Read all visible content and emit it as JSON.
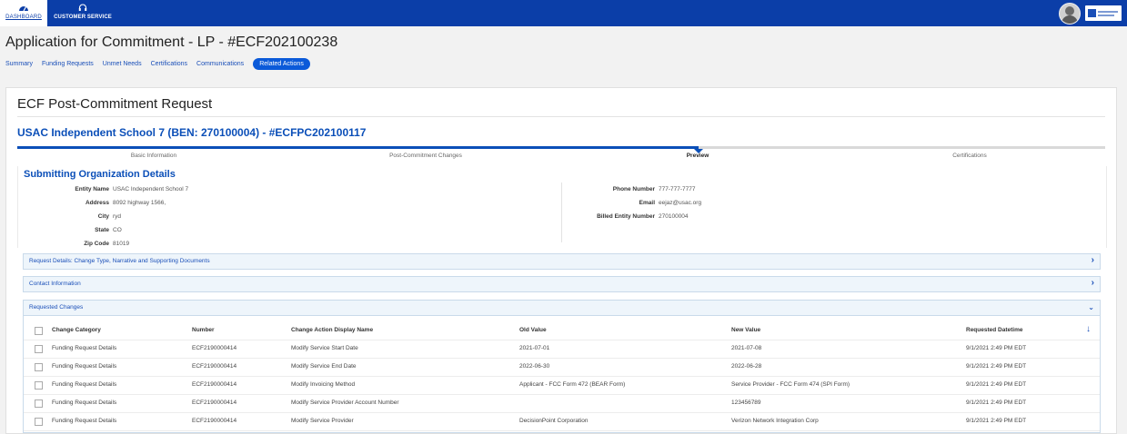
{
  "nav": {
    "dashboard": "DASHBOARD",
    "customer_service": "CUSTOMER SERVICE"
  },
  "page": {
    "title": "Application for Commitment - LP - #ECF202100238",
    "tabs": [
      {
        "label": "Summary"
      },
      {
        "label": "Funding Requests"
      },
      {
        "label": "Unmet Needs"
      },
      {
        "label": "Certifications"
      },
      {
        "label": "Communications"
      },
      {
        "label": "Related Actions",
        "active": true
      }
    ]
  },
  "card": {
    "title": "ECF Post-Commitment Request",
    "entity_header": "USAC Independent School 7 (BEN: 270100004) - #ECFPC202100117",
    "steps": [
      "Basic Information",
      "Post-Commitment Changes",
      "Preview",
      "Certifications"
    ],
    "active_step": 2
  },
  "org": {
    "title": "Submitting Organization Details",
    "left": [
      {
        "label": "Entity Name",
        "value": "USAC Independent School 7"
      },
      {
        "label": "Address",
        "value": "8092 highway 1566,"
      },
      {
        "label": "City",
        "value": "ryd"
      },
      {
        "label": "State",
        "value": "CO"
      },
      {
        "label": "Zip Code",
        "value": "81019"
      }
    ],
    "right": [
      {
        "label": "Phone Number",
        "value": "777-777-7777"
      },
      {
        "label": "Email",
        "value": "eejaz@usac.org"
      },
      {
        "label": "Billed Entity Number",
        "value": "270100004"
      }
    ]
  },
  "accordions": {
    "request_details": "Request Details: Change Type, Narrative and Supporting Documents",
    "contact_info": "Contact Information",
    "requested_changes": "Requested Changes"
  },
  "table": {
    "columns": [
      "Change Category",
      "Number",
      "Change Action Display Name",
      "Old Value",
      "New Value",
      "Requested Datetime"
    ],
    "rows": [
      [
        "Funding Request Details",
        "ECF2190000414",
        "Modify Service Start Date",
        "2021-07-01",
        "2021-07-08",
        "9/1/2021 2:49 PM EDT"
      ],
      [
        "Funding Request Details",
        "ECF2190000414",
        "Modify Service End Date",
        "2022-06-30",
        "2022-06-28",
        "9/1/2021 2:49 PM EDT"
      ],
      [
        "Funding Request Details",
        "ECF2190000414",
        "Modify Invoicing Method",
        "Applicant - FCC Form 472 (BEAR Form)",
        "Service Provider - FCC Form 474 (SPI Form)",
        "9/1/2021 2:49 PM EDT"
      ],
      [
        "Funding Request Details",
        "ECF2190000414",
        "Modify Service Provider Account Number",
        "",
        "123456789",
        "9/1/2021 2:49 PM EDT"
      ],
      [
        "Funding Request Details",
        "ECF2190000414",
        "Modify Service Provider",
        "DecisionPoint Corporation",
        "Verizon Network Integration Corp",
        "9/1/2021 2:49 PM EDT"
      ]
    ]
  }
}
